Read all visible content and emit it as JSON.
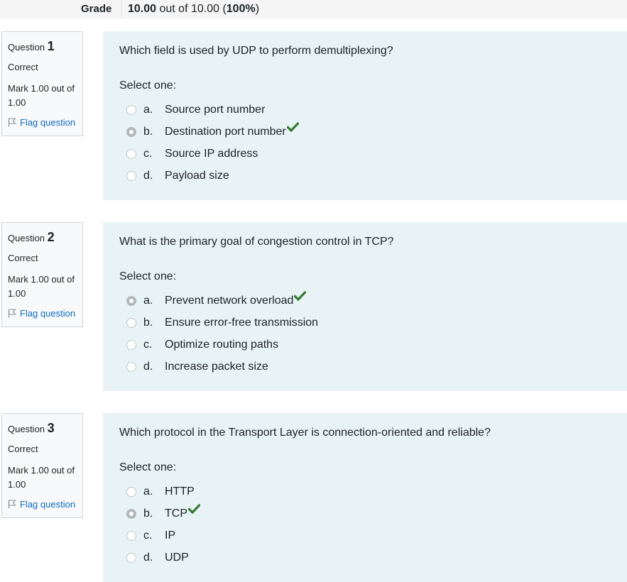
{
  "grade": {
    "label": "Grade",
    "score": "10.00",
    "out_of_text": " out of 10.00 (",
    "percent": "100%",
    "close_paren": ")"
  },
  "questions": [
    {
      "question_label": "Question ",
      "number": "1",
      "state": "Correct",
      "mark": "Mark 1.00 out of 1.00",
      "flag_label": "Flag question",
      "text": "Which field is used by UDP to perform demultiplexing?",
      "prompt": "Select one:",
      "answers": [
        {
          "letter": "a.",
          "text": "Source port number",
          "selected": false,
          "correct": false
        },
        {
          "letter": "b.",
          "text": "Destination port number",
          "selected": true,
          "correct": true
        },
        {
          "letter": "c.",
          "text": "Source IP address",
          "selected": false,
          "correct": false
        },
        {
          "letter": "d.",
          "text": "Payload size",
          "selected": false,
          "correct": false
        }
      ]
    },
    {
      "question_label": "Question ",
      "number": "2",
      "state": "Correct",
      "mark": "Mark 1.00 out of 1.00",
      "flag_label": "Flag question",
      "text": "What is the primary goal of congestion control in TCP?",
      "prompt": "Select one:",
      "answers": [
        {
          "letter": "a.",
          "text": "Prevent network overload",
          "selected": true,
          "correct": true
        },
        {
          "letter": "b.",
          "text": "Ensure error-free transmission",
          "selected": false,
          "correct": false
        },
        {
          "letter": "c.",
          "text": "Optimize routing paths",
          "selected": false,
          "correct": false
        },
        {
          "letter": "d.",
          "text": "Increase packet size",
          "selected": false,
          "correct": false
        }
      ]
    },
    {
      "question_label": "Question ",
      "number": "3",
      "state": "Correct",
      "mark": "Mark 1.00 out of 1.00",
      "flag_label": "Flag question",
      "text": "Which protocol in the Transport Layer is connection-oriented and reliable?",
      "prompt": "Select one:",
      "answers": [
        {
          "letter": "a.",
          "text": "HTTP",
          "selected": false,
          "correct": false
        },
        {
          "letter": "b.",
          "text": "TCP",
          "selected": true,
          "correct": true
        },
        {
          "letter": "c.",
          "text": "IP",
          "selected": false,
          "correct": false
        },
        {
          "letter": "d.",
          "text": "UDP",
          "selected": false,
          "correct": false
        }
      ]
    }
  ],
  "colors": {
    "correct_tick": "#357a32",
    "link": "#0f6cbf",
    "content_bg": "#e7f3f5",
    "info_bg": "#f8f9fa"
  },
  "icons": {
    "flag": "flag-icon",
    "correct": "check-icon"
  }
}
